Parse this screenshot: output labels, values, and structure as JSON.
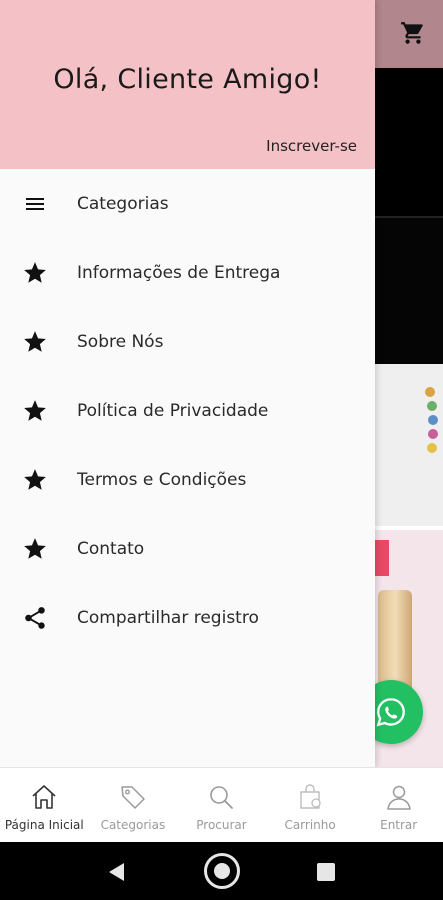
{
  "drawer": {
    "greeting": "Olá, Cliente Amigo!",
    "signup_label": "Inscrever-se",
    "header_color": "#f4c2c6",
    "items": [
      {
        "label": "Categorias",
        "icon": "menu-icon"
      },
      {
        "label": "Informações de Entrega",
        "icon": "star-icon"
      },
      {
        "label": "Sobre Nós",
        "icon": "star-icon"
      },
      {
        "label": "Política de Privacidade",
        "icon": "star-icon"
      },
      {
        "label": "Termos e Condições",
        "icon": "star-icon"
      },
      {
        "label": "Contato",
        "icon": "star-icon"
      },
      {
        "label": "Compartilhar registro",
        "icon": "share-icon"
      }
    ]
  },
  "bottom_nav": {
    "items": [
      {
        "label": "Página Inicial",
        "icon": "home-icon",
        "active": true
      },
      {
        "label": "Categorias",
        "icon": "tag-icon",
        "active": false
      },
      {
        "label": "Procurar",
        "icon": "search-icon",
        "active": false
      },
      {
        "label": "Carrinho",
        "icon": "shopping-bag-icon",
        "active": false
      },
      {
        "label": "Entrar",
        "icon": "user-icon",
        "active": false
      }
    ]
  },
  "colors": {
    "whatsapp": "#22c063"
  }
}
